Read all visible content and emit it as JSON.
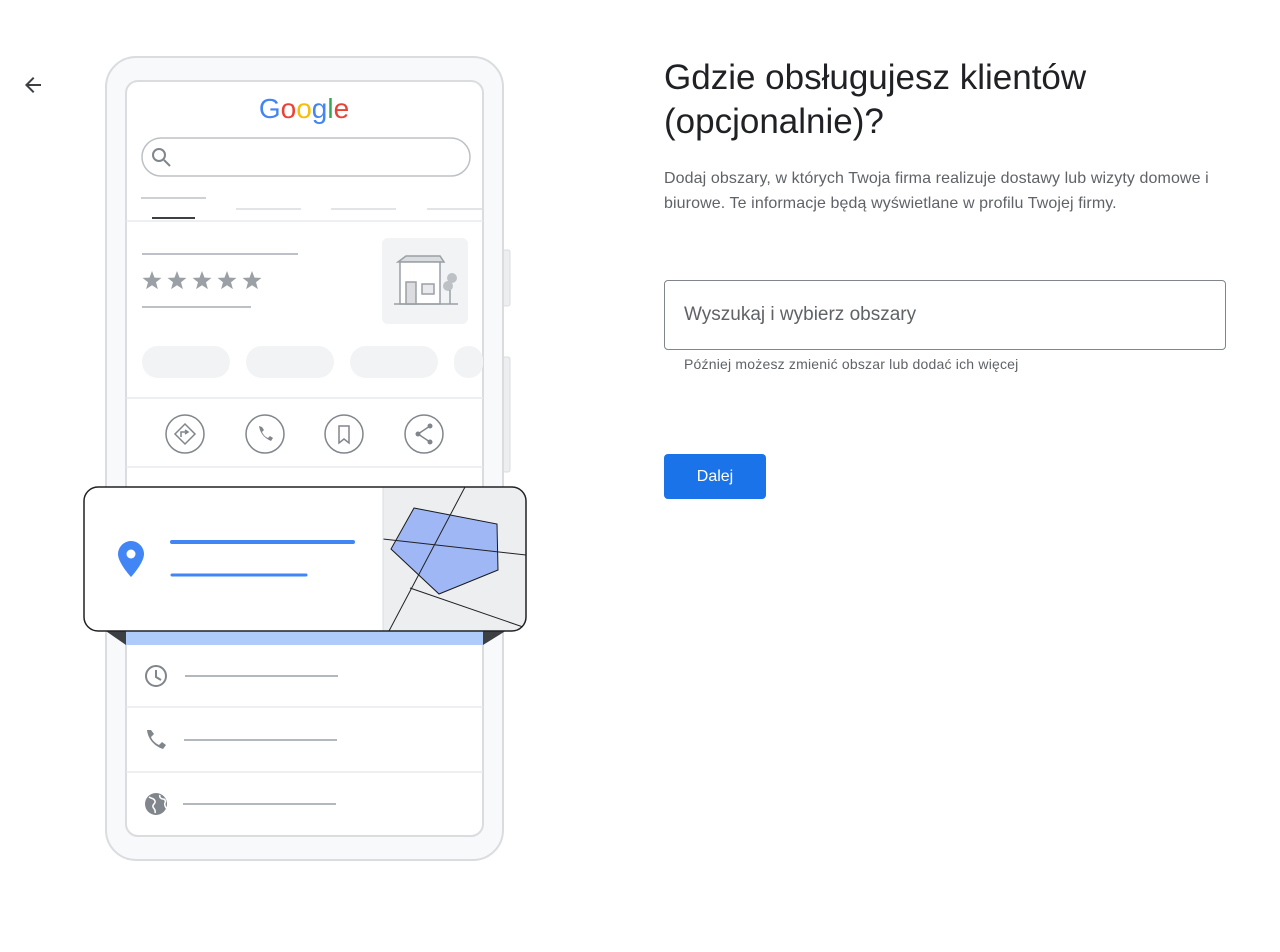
{
  "navigation": {
    "back_icon": "arrow-back-icon"
  },
  "illustration": {
    "brand_logo": {
      "text": "Google",
      "colors": [
        "#4285F4",
        "#EA4335",
        "#FBBC05",
        "#4285F4",
        "#34A853",
        "#EA4335"
      ]
    },
    "rating_stars": 5,
    "action_icons": [
      "directions-icon",
      "phone-icon",
      "bookmark-icon",
      "share-icon"
    ],
    "detail_icons": [
      "clock-icon",
      "phone-icon",
      "globe-icon"
    ],
    "accent_color": "#4285F4",
    "area_fill_color": "#9FB8F5"
  },
  "main": {
    "title": "Gdzie obsługujesz klientów (opcjonalnie)?",
    "description": "Dodaj obszary, w których Twoja firma realizuje dostawy lub wizyty domowe i biurowe. Te informacje będą wyświetlane w profilu Twojej firmy.",
    "search": {
      "placeholder": "Wyszukaj i wybierz obszary",
      "value": ""
    },
    "helper_text": "Później możesz zmienić obszar lub dodać ich więcej",
    "next_button_label": "Dalej"
  },
  "colors": {
    "primary": "#1A73E8",
    "text_primary": "#202124",
    "text_secondary": "#5F6368",
    "border": "#80868B"
  }
}
